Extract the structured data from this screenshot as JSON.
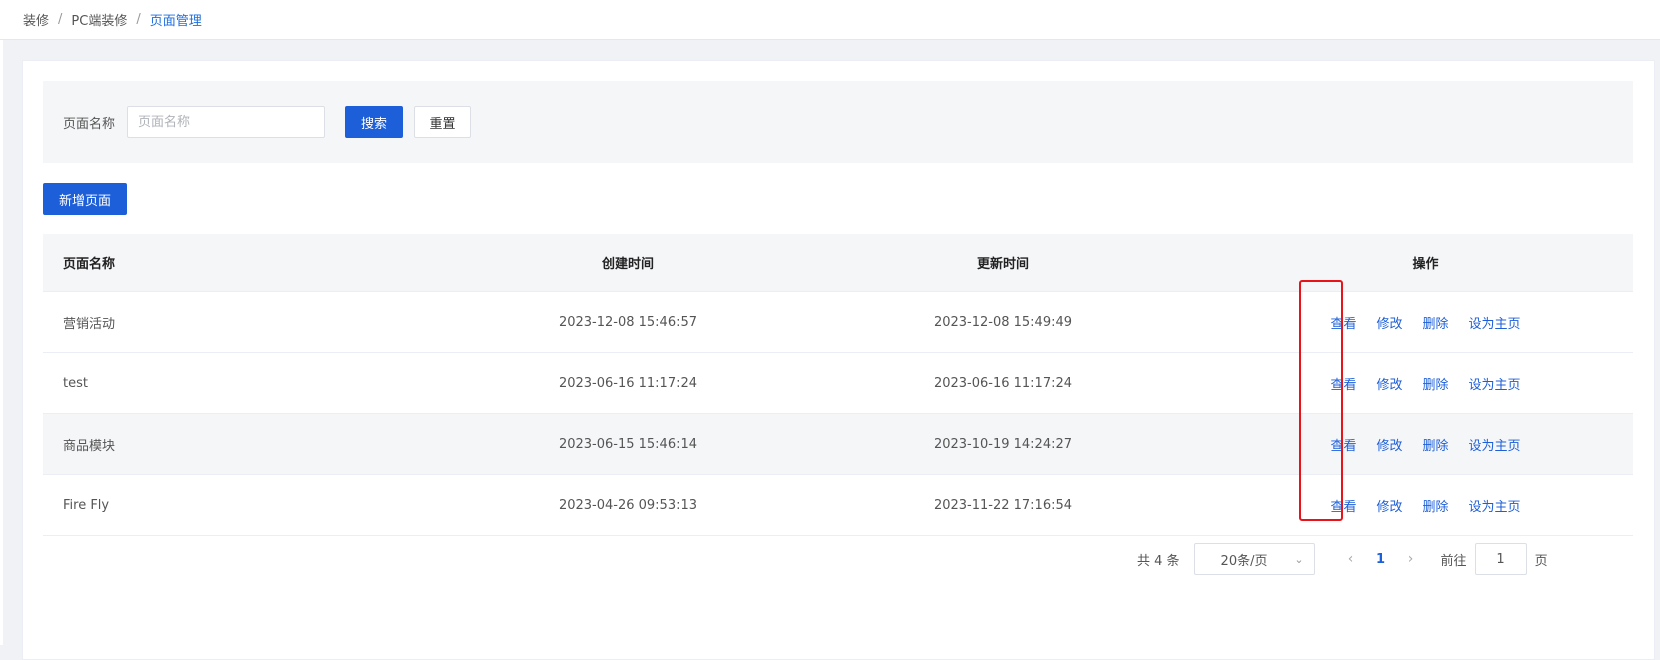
{
  "breadcrumb": {
    "items": [
      "装修",
      "PC端装修",
      "页面管理"
    ]
  },
  "search": {
    "label": "页面名称",
    "placeholder": "页面名称",
    "value": "",
    "search_label": "搜索",
    "reset_label": "重置"
  },
  "toolbar": {
    "add_label": "新增页面"
  },
  "table": {
    "headers": [
      "页面名称",
      "创建时间",
      "更新时间",
      "操作"
    ],
    "rows": [
      {
        "name": "营销活动",
        "created": "2023-12-08 15:46:57",
        "updated": "2023-12-08 15:49:49"
      },
      {
        "name": "test",
        "created": "2023-06-16 11:17:24",
        "updated": "2023-06-16 11:17:24"
      },
      {
        "name": "商品模块",
        "created": "2023-06-15 15:46:14",
        "updated": "2023-10-19 14:24:27"
      },
      {
        "name": "Fire Fly",
        "created": "2023-04-26 09:53:13",
        "updated": "2023-11-22 17:16:54"
      }
    ],
    "actions": {
      "view": "查看",
      "edit": "修改",
      "delete": "删除",
      "set_home": "设为主页"
    }
  },
  "pagination": {
    "total_text": "共 4 条",
    "page_size": "20条/页",
    "current_page": "1",
    "goto_label": "前往",
    "goto_value": "1",
    "page_suffix": "页"
  },
  "colors": {
    "primary": "#1d5fd8",
    "highlight": "#e8141a"
  },
  "icons": {
    "prev": "chevron-left-icon",
    "next": "chevron-right-icon",
    "select": "chevron-down-icon"
  }
}
